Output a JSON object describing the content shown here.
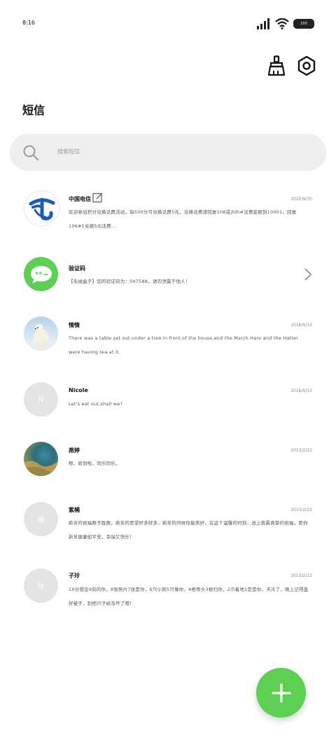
{
  "status_bar": {
    "time": "8:16",
    "battery": "100"
  },
  "header": {
    "title": "短信",
    "actions": [
      {
        "name": "broom-icon"
      },
      {
        "name": "settings-hex-icon"
      }
    ]
  },
  "search": {
    "placeholder": "搜索短信"
  },
  "messages": [
    {
      "sender": "中国电信",
      "date": "2025/9/30",
      "preview": "欢迎参加积分兑换话费活动，每500分可兑换话费5元，兑换话费请回复106或jfdh#话费金额到10001，回复106#5兑换5元话费...",
      "avatar": "china-telecom-logo"
    },
    {
      "sender": "验证码",
      "date": "",
      "preview": "【毛绒盒子】您的验证码为：047588，请勿泄露于他人！",
      "avatar": "sms-code-icon"
    },
    {
      "sender": "情情",
      "date": "2016/6/13",
      "preview": "There was a table set out under a tree in front of the house,and the March Hare and the Hatter were having tea at it.",
      "avatar": "polar-bear-photo"
    },
    {
      "sender": "Nicole",
      "date": "2016/6/13",
      "preview": "Let's eat out,shall we?",
      "avatar_letter": "N"
    },
    {
      "sender": "燕婷",
      "date": "2013/2/22",
      "preview": "嗯，收到啦，同乐同乐。",
      "avatar": "landscape-photo"
    },
    {
      "sender": "紫楠",
      "date": "2013/2/22",
      "preview": "新年的祝福数不胜数，新年的愿望好多好多，新年的问候你能美好，在这个温馨的时刻，送上我最真挚的祝福，愿你新年健康如平安，幸福又快乐！",
      "avatar_letter": "楠"
    },
    {
      "sender": "子玲",
      "date": "2013/2/22",
      "preview": "10分想念9刻的你，8张照片7张是你，6只小狗5只像你，4根骨头3根归你，2爪着地1定是你，天冷了，晚上记得盖好被子，别把爪子给冻坏了哦！",
      "avatar_letter": "玲"
    }
  ],
  "colors": {
    "accent_green": "#5dcf52",
    "telecom_blue": "#1c5cb5",
    "search_bg": "#eeeeee"
  },
  "fab": {
    "icon": "plus-icon"
  }
}
